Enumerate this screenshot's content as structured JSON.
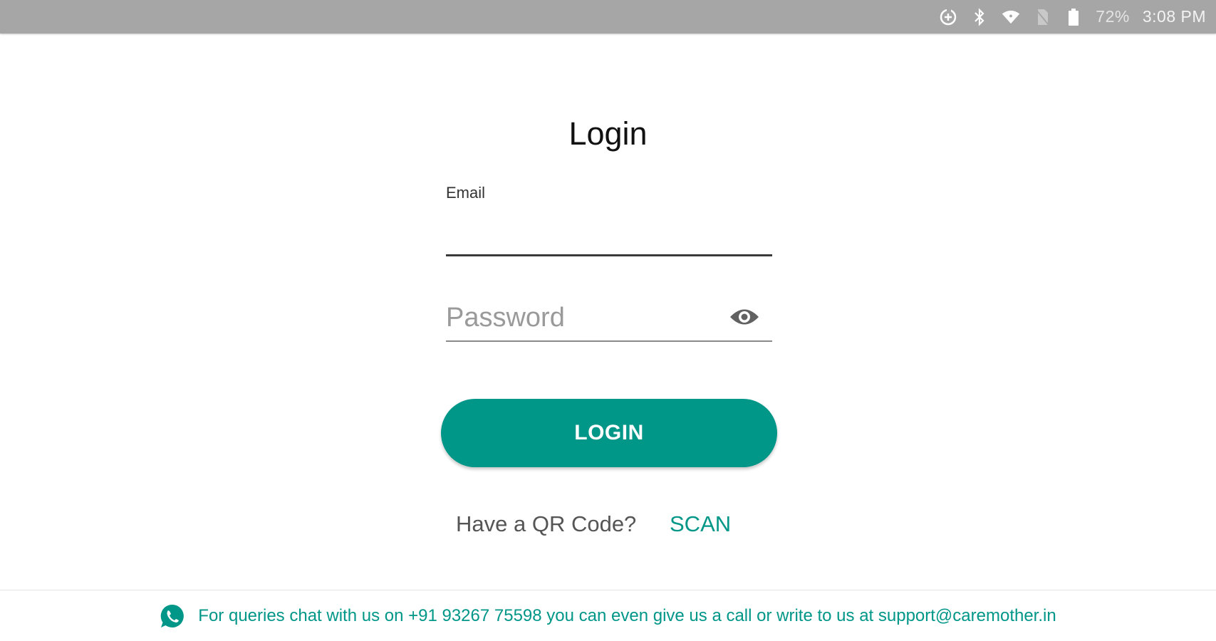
{
  "status_bar": {
    "battery_percent": "72%",
    "time": "3:08 PM",
    "icons": [
      "data-saver-icon",
      "bluetooth-icon",
      "wifi-icon",
      "no-sim-icon",
      "battery-icon"
    ]
  },
  "login": {
    "title": "Login",
    "email_label": "Email",
    "email_value": "",
    "password_placeholder": "Password",
    "password_value": "",
    "login_button": "LOGIN",
    "qr_prompt": "Have a QR Code?",
    "scan_label": "SCAN"
  },
  "footer": {
    "text": "For queries chat with us on +91 93267 75598 you can even give us a call or write to us at support@caremother.in",
    "icon": "whatsapp-icon"
  },
  "colors": {
    "accent": "#009688",
    "status_bar": "#a6a6a6"
  }
}
